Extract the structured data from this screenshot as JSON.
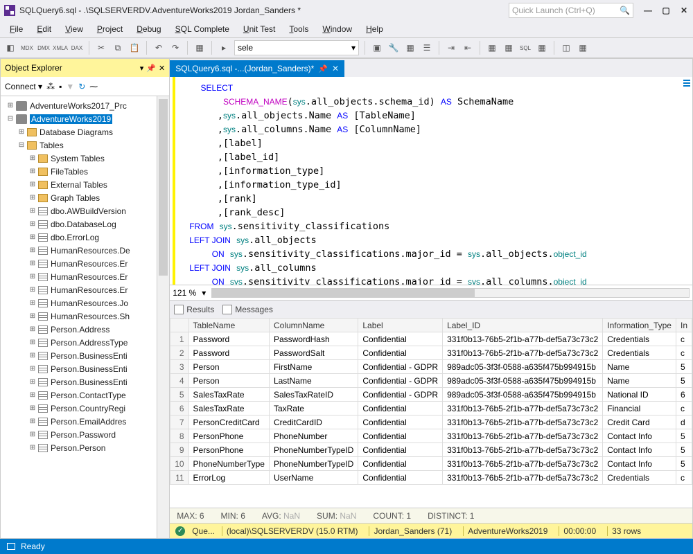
{
  "title": "SQLQuery6.sql - .\\SQLSERVERDV.AdventureWorks2019 Jordan_Sanders *",
  "quicklaunch_placeholder": "Quick Launch (Ctrl+Q)",
  "menu": [
    "File",
    "Edit",
    "View",
    "Project",
    "Debug",
    "SQL Complete",
    "Unit Test",
    "Tools",
    "Window",
    "Help"
  ],
  "toolbar_combo": "sele",
  "object_explorer": {
    "title": "Object Explorer",
    "connect": "Connect",
    "databases": [
      {
        "name": "AdventureWorks2017_Prc",
        "depth": 0,
        "toggle": "+",
        "icon": "db"
      },
      {
        "name": "AdventureWorks2019",
        "depth": 0,
        "toggle": "–",
        "icon": "db",
        "selected": true
      },
      {
        "name": "Database Diagrams",
        "depth": 1,
        "toggle": "+",
        "icon": "folder"
      },
      {
        "name": "Tables",
        "depth": 1,
        "toggle": "–",
        "icon": "folder"
      },
      {
        "name": "System Tables",
        "depth": 2,
        "toggle": "+",
        "icon": "folder"
      },
      {
        "name": "FileTables",
        "depth": 2,
        "toggle": "+",
        "icon": "folder"
      },
      {
        "name": "External Tables",
        "depth": 2,
        "toggle": "+",
        "icon": "folder"
      },
      {
        "name": "Graph Tables",
        "depth": 2,
        "toggle": "+",
        "icon": "folder"
      },
      {
        "name": "dbo.AWBuildVersion",
        "depth": 2,
        "toggle": "+",
        "icon": "table"
      },
      {
        "name": "dbo.DatabaseLog",
        "depth": 2,
        "toggle": "+",
        "icon": "table"
      },
      {
        "name": "dbo.ErrorLog",
        "depth": 2,
        "toggle": "+",
        "icon": "table"
      },
      {
        "name": "HumanResources.De",
        "depth": 2,
        "toggle": "+",
        "icon": "table"
      },
      {
        "name": "HumanResources.Er",
        "depth": 2,
        "toggle": "+",
        "icon": "table"
      },
      {
        "name": "HumanResources.Er",
        "depth": 2,
        "toggle": "+",
        "icon": "table"
      },
      {
        "name": "HumanResources.Er",
        "depth": 2,
        "toggle": "+",
        "icon": "table"
      },
      {
        "name": "HumanResources.Jo",
        "depth": 2,
        "toggle": "+",
        "icon": "table"
      },
      {
        "name": "HumanResources.Sh",
        "depth": 2,
        "toggle": "+",
        "icon": "table"
      },
      {
        "name": "Person.Address",
        "depth": 2,
        "toggle": "+",
        "icon": "table"
      },
      {
        "name": "Person.AddressType",
        "depth": 2,
        "toggle": "+",
        "icon": "table"
      },
      {
        "name": "Person.BusinessEnti",
        "depth": 2,
        "toggle": "+",
        "icon": "table"
      },
      {
        "name": "Person.BusinessEnti",
        "depth": 2,
        "toggle": "+",
        "icon": "table"
      },
      {
        "name": "Person.BusinessEnti",
        "depth": 2,
        "toggle": "+",
        "icon": "table"
      },
      {
        "name": "Person.ContactType",
        "depth": 2,
        "toggle": "+",
        "icon": "table"
      },
      {
        "name": "Person.CountryRegi",
        "depth": 2,
        "toggle": "+",
        "icon": "table"
      },
      {
        "name": "Person.EmailAddres",
        "depth": 2,
        "toggle": "+",
        "icon": "table"
      },
      {
        "name": "Person.Password",
        "depth": 2,
        "toggle": "+",
        "icon": "table"
      },
      {
        "name": "Person.Person",
        "depth": 2,
        "toggle": "+",
        "icon": "table"
      }
    ]
  },
  "doc_tab": "SQLQuery6.sql -...(Jordan_Sanders)*",
  "sql_lines": [
    {
      "t": "SELECT",
      "cls": "kw",
      "indent": 1
    },
    {
      "html": "    <span class='fn'>SCHEMA_NAME</span>(<span class='id'>sys</span>.all_objects.schema_id) <span class='kw'>AS</span> SchemaName",
      "indent": 1
    },
    {
      "html": "   ,<span class='id'>sys</span>.all_objects.Name <span class='kw'>AS</span> [TableName]",
      "indent": 1
    },
    {
      "html": "   ,<span class='id'>sys</span>.all_columns.Name <span class='kw'>AS</span> [ColumnName]",
      "indent": 1
    },
    {
      "html": "   ,[label]",
      "indent": 1
    },
    {
      "html": "   ,[label_id]",
      "indent": 1
    },
    {
      "html": "   ,[information_type]",
      "indent": 1
    },
    {
      "html": "   ,[information_type_id]",
      "indent": 1
    },
    {
      "html": "   ,[rank]",
      "indent": 1
    },
    {
      "html": "   ,[rank_desc]",
      "indent": 1
    },
    {
      "html": "<span class='kw'>FROM</span> <span class='id'>sys</span>.sensitivity_classifications",
      "indent": 0
    },
    {
      "html": "<span class='kw'>LEFT JOIN</span> <span class='id'>sys</span>.all_objects",
      "indent": 0
    },
    {
      "html": "    <span class='kw'>ON</span> <span class='id'>sys</span>.sensitivity_classifications.major_id = <span class='id'>sys</span>.all_objects.<span class='id'>object_id</span>",
      "indent": 0
    },
    {
      "html": "<span class='kw'>LEFT JOIN</span> <span class='id'>sys</span>.all_columns",
      "indent": 0
    },
    {
      "html": "    <span class='kw'>ON</span> <span class='id'>sys</span>.sensitivity_classifications.major_id = <span class='id'>sys</span>.all_columns.<span class='id'>object_id</span>",
      "indent": 0
    }
  ],
  "zoom": "121 %",
  "results": {
    "tab_results": "Results",
    "tab_messages": "Messages",
    "columns": [
      "",
      "TableName",
      "ColumnName",
      "Label",
      "Label_ID",
      "Information_Type",
      "In"
    ],
    "rows": [
      [
        "1",
        "Password",
        "PasswordHash",
        "Confidential",
        "331f0b13-76b5-2f1b-a77b-def5a73c73c2",
        "Credentials",
        "c"
      ],
      [
        "2",
        "Password",
        "PasswordSalt",
        "Confidential",
        "331f0b13-76b5-2f1b-a77b-def5a73c73c2",
        "Credentials",
        "c"
      ],
      [
        "3",
        "Person",
        "FirstName",
        "Confidential - GDPR",
        "989adc05-3f3f-0588-a635f475b994915b",
        "Name",
        "5"
      ],
      [
        "4",
        "Person",
        "LastName",
        "Confidential - GDPR",
        "989adc05-3f3f-0588-a635f475b994915b",
        "Name",
        "5"
      ],
      [
        "5",
        "SalesTaxRate",
        "SalesTaxRateID",
        "Confidential - GDPR",
        "989adc05-3f3f-0588-a635f475b994915b",
        "National ID",
        "6"
      ],
      [
        "6",
        "SalesTaxRate",
        "TaxRate",
        "Confidential",
        "331f0b13-76b5-2f1b-a77b-def5a73c73c2",
        "Financial",
        "c"
      ],
      [
        "7",
        "PersonCreditCard",
        "CreditCardID",
        "Confidential",
        "331f0b13-76b5-2f1b-a77b-def5a73c73c2",
        "Credit Card",
        "d"
      ],
      [
        "8",
        "PersonPhone",
        "PhoneNumber",
        "Confidential",
        "331f0b13-76b5-2f1b-a77b-def5a73c73c2",
        "Contact Info",
        "5"
      ],
      [
        "9",
        "PersonPhone",
        "PhoneNumberTypeID",
        "Confidential",
        "331f0b13-76b5-2f1b-a77b-def5a73c73c2",
        "Contact Info",
        "5"
      ],
      [
        "10",
        "PhoneNumberType",
        "PhoneNumberTypeID",
        "Confidential",
        "331f0b13-76b5-2f1b-a77b-def5a73c73c2",
        "Contact Info",
        "5"
      ],
      [
        "11",
        "ErrorLog",
        "UserName",
        "Confidential",
        "331f0b13-76b5-2f1b-a77b-def5a73c73c2",
        "Credentials",
        "c"
      ]
    ],
    "agg": {
      "max": "MAX: 6",
      "min": "MIN: 6",
      "avg": "AVG: NaN",
      "sum": "SUM: NaN",
      "count": "COUNT: 1",
      "distinct": "DISTINCT: 1"
    }
  },
  "statusbar": {
    "query": "Que...",
    "server": "(local)\\SQLSERVERDV (15.0 RTM)",
    "user": "Jordan_Sanders (71)",
    "db": "AdventureWorks2019",
    "time": "00:00:00",
    "rows": "33 rows"
  },
  "bottom": "Ready"
}
